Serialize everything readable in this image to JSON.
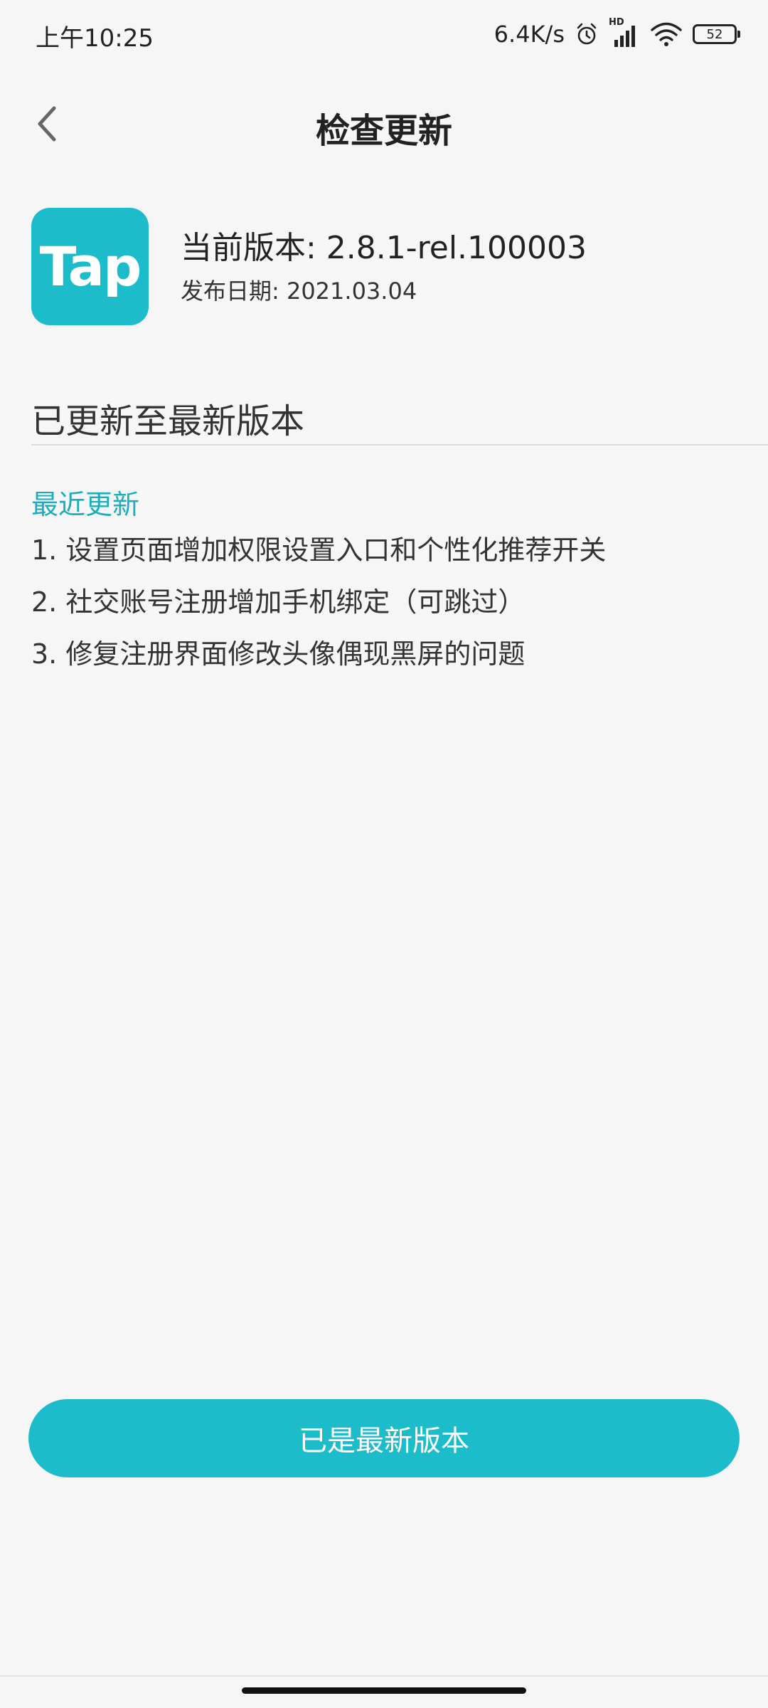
{
  "status_bar": {
    "time": "上午10:25",
    "network_speed": "6.4K/s",
    "network_type": "HD",
    "battery_level": "52",
    "icons": [
      "alarm-icon",
      "signal-icon",
      "wifi-icon",
      "battery-icon"
    ]
  },
  "app_bar": {
    "title": "检查更新",
    "back_icon": "chevron-left-icon"
  },
  "app_info": {
    "logo_text": "Tap",
    "current_version": "当前版本: 2.8.1-rel.100003",
    "release_date": "发布日期: 2021.03.04"
  },
  "update_status": "已更新至最新版本",
  "recent_updates": {
    "title": "最近更新",
    "items": [
      "1. 设置页面增加权限设置入口和个性化推荐开关",
      "2. 社交账号注册增加手机绑定（可跳过）",
      "3. 修复注册界面修改头像偶现黑屏的问题"
    ]
  },
  "action_button": {
    "label": "已是最新版本"
  },
  "colors": {
    "accent": "#1dbccb",
    "section_title": "#1aaebd",
    "background": "#f6f6f6"
  }
}
